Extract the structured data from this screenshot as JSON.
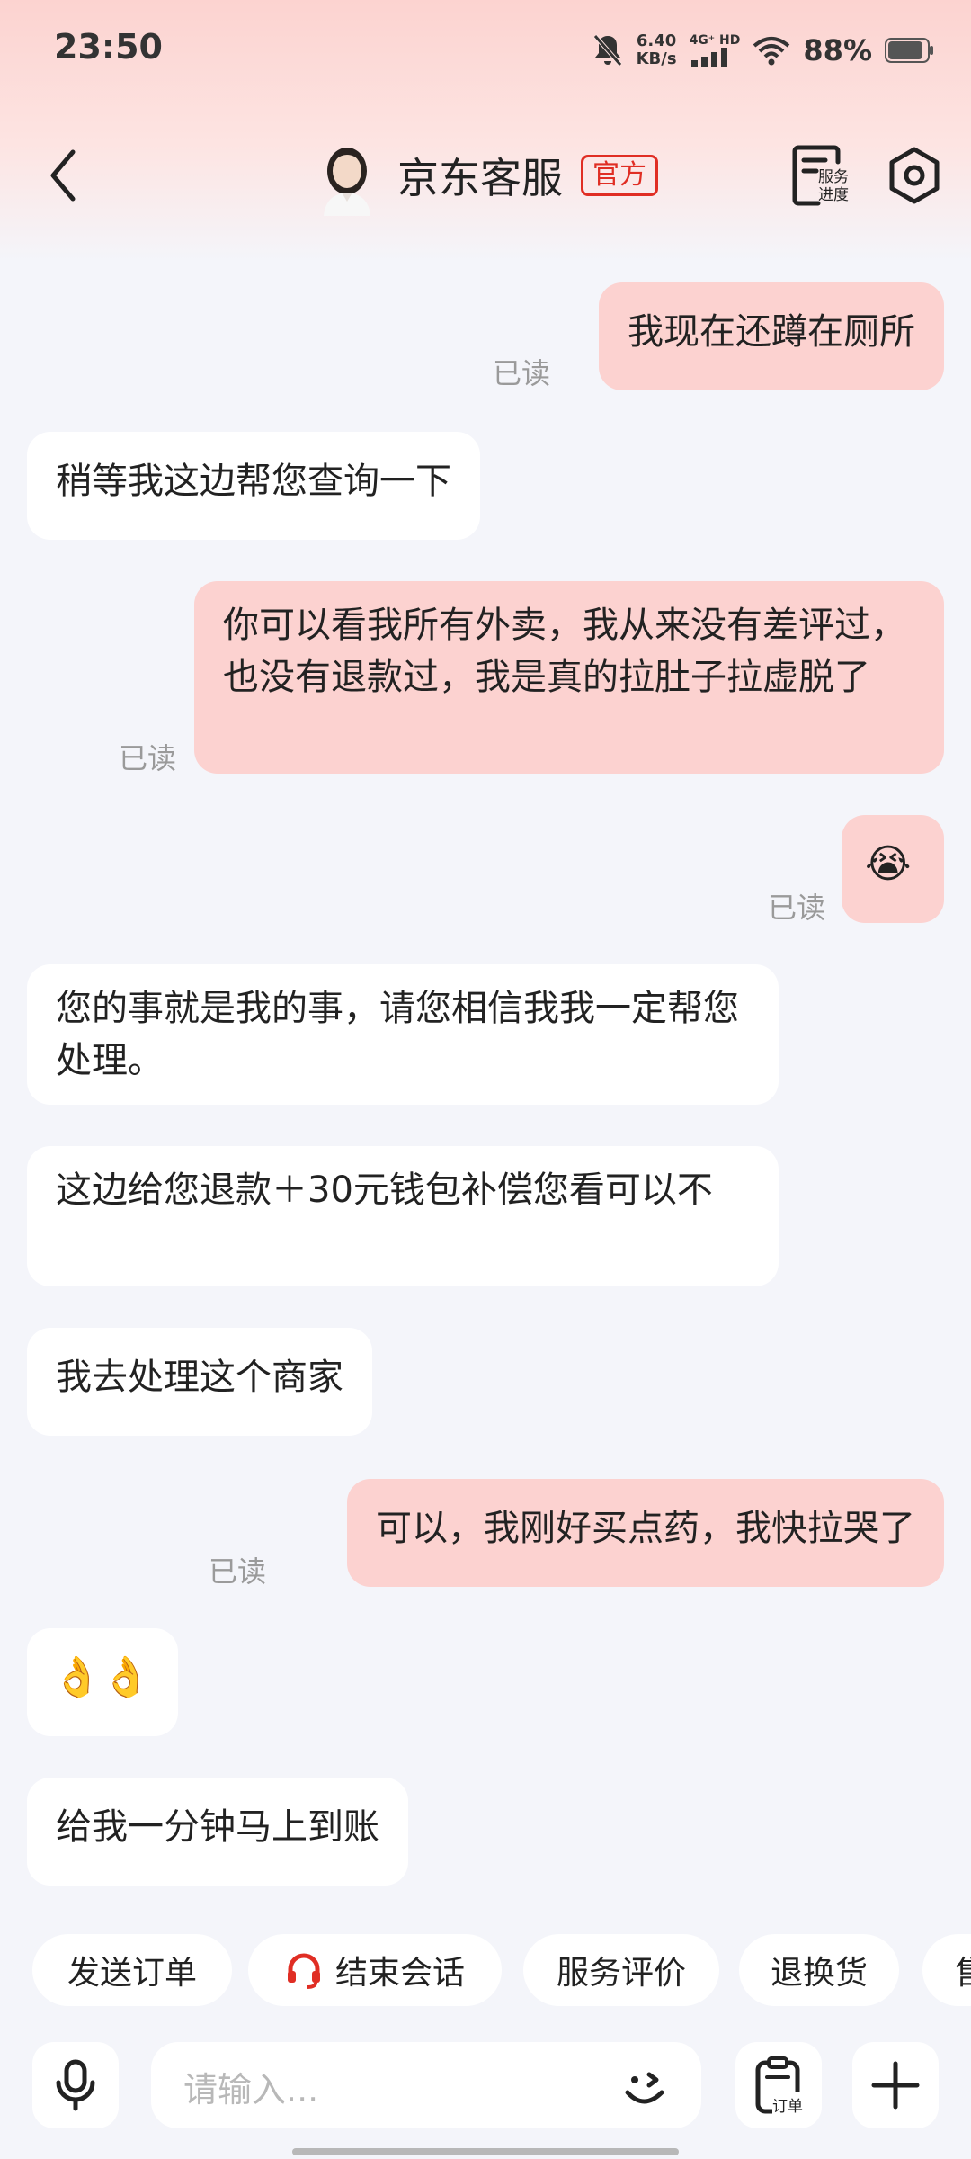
{
  "status_bar": {
    "time": "23:50",
    "speed_value": "6.40",
    "speed_unit": "KB/s",
    "network": "4G⁺ HD",
    "battery": "88%"
  },
  "header": {
    "title": "京东客服",
    "badge": "官方",
    "service_progress_line1": "服务",
    "service_progress_line2": "进度"
  },
  "messages": [
    {
      "side": "right",
      "text": "我现在还蹲在厕所",
      "read": "已读"
    },
    {
      "side": "left",
      "text": "稍等我这边帮您查询一下"
    },
    {
      "side": "right",
      "text": "你可以看我所有外卖，我从来没有差评过，也没有退款过，我是真的拉肚子拉虚脱了",
      "read": "已读"
    },
    {
      "side": "right",
      "text": "😭",
      "read": "已读"
    },
    {
      "side": "left",
      "text": "您的事就是我的事，请您相信我我一定帮您处理。"
    },
    {
      "side": "left",
      "text": "这边给您退款＋30元钱包补偿您看可以不"
    },
    {
      "side": "left",
      "text": "我去处理这个商家"
    },
    {
      "side": "right",
      "text": "可以，我刚好买点药，我快拉哭了",
      "read": "已读"
    },
    {
      "side": "left",
      "text": "👌👌"
    },
    {
      "side": "left",
      "text": "给我一分钟马上到账"
    }
  ],
  "quick_actions": [
    "发送订单",
    "结束会话",
    "服务评价",
    "退换货",
    "售"
  ],
  "input": {
    "placeholder": "请输入...",
    "order_label": "订单"
  },
  "colors": {
    "accent": "#e02e24",
    "outgoing_bubble": "#fcd2d0",
    "incoming_bubble": "#ffffff",
    "background": "#f4f5fa"
  },
  "icons": [
    "back-arrow-icon",
    "service-progress-icon",
    "settings-icon",
    "headset-icon",
    "microphone-icon",
    "emoji-icon",
    "order-clipboard-icon",
    "plus-icon"
  ]
}
